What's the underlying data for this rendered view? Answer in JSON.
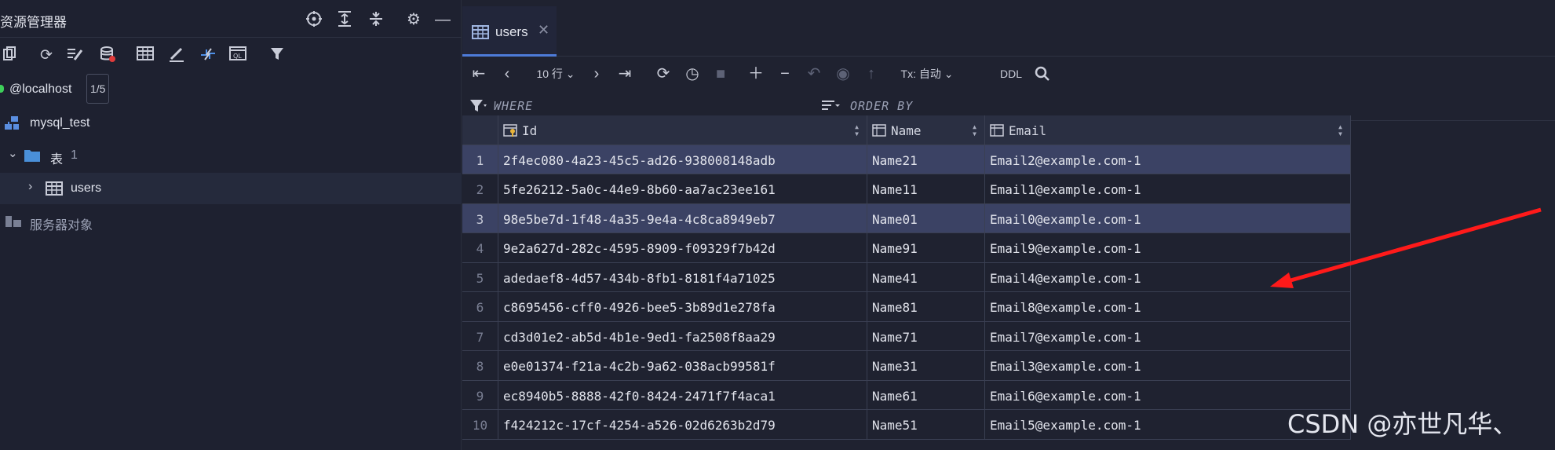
{
  "left_panel": {
    "title": "资源管理器",
    "tree": {
      "connection": {
        "label": "@localhost",
        "badge": "1/5"
      },
      "database": {
        "label": "mysql_test"
      },
      "tables_folder": {
        "label": "表",
        "count": "1"
      },
      "table_item": {
        "label": "users"
      },
      "server_objects": {
        "label": "服务器对象"
      }
    }
  },
  "editor": {
    "tab": {
      "label": "users"
    },
    "toolbar": {
      "page_size": "10 行",
      "tx_mode": "Tx: 自动",
      "ddl": "DDL"
    },
    "filter": {
      "where": "WHERE",
      "order_by": "ORDER BY"
    }
  },
  "table": {
    "columns": [
      "Id",
      "Name",
      "Email"
    ],
    "rows": [
      {
        "num": "1",
        "id": "2f4ec080-4a23-45c5-ad26-938008148adb",
        "name": "Name21",
        "email": "Email2@example.com-1",
        "highlight": true
      },
      {
        "num": "2",
        "id": "5fe26212-5a0c-44e9-8b60-aa7ac23ee161",
        "name": "Name11",
        "email": "Email1@example.com-1",
        "highlight": false
      },
      {
        "num": "3",
        "id": "98e5be7d-1f48-4a35-9e4a-4c8ca8949eb7",
        "name": "Name01",
        "email": "Email0@example.com-1",
        "highlight": true
      },
      {
        "num": "4",
        "id": "9e2a627d-282c-4595-8909-f09329f7b42d",
        "name": "Name91",
        "email": "Email9@example.com-1",
        "highlight": false
      },
      {
        "num": "5",
        "id": "adedaef8-4d57-434b-8fb1-8181f4a71025",
        "name": "Name41",
        "email": "Email4@example.com-1",
        "highlight": false
      },
      {
        "num": "6",
        "id": "c8695456-cff0-4926-bee5-3b89d1e278fa",
        "name": "Name81",
        "email": "Email8@example.com-1",
        "highlight": false
      },
      {
        "num": "7",
        "id": "cd3d01e2-ab5d-4b1e-9ed1-fa2508f8aa29",
        "name": "Name71",
        "email": "Email7@example.com-1",
        "highlight": false
      },
      {
        "num": "8",
        "id": "e0e01374-f21a-4c2b-9a62-038acb99581f",
        "name": "Name31",
        "email": "Email3@example.com-1",
        "highlight": false
      },
      {
        "num": "9",
        "id": "ec8940b5-8888-42f0-8424-2471f7f4aca1",
        "name": "Name61",
        "email": "Email6@example.com-1",
        "highlight": false
      },
      {
        "num": "10",
        "id": "f424212c-17cf-4254-a526-02d6263b2d79",
        "name": "Name51",
        "email": "Email5@example.com-1",
        "highlight": false
      }
    ]
  },
  "watermark": "CSDN @亦世凡华、",
  "colors": {
    "accent": "#4d7bd8",
    "row_highlight": "#3b4264",
    "annotation_arrow": "#ff1a1a",
    "connection_status": "#3ecf5a"
  },
  "icons": [
    "target-icon",
    "expand-all-icon",
    "collapse-all-icon",
    "gear-icon",
    "minimize-icon",
    "copy-icon",
    "refresh-icon",
    "edit-icon",
    "database-icon",
    "table-icon",
    "pen-icon",
    "compare-icon",
    "query-icon",
    "filter-icon",
    "first-page-icon",
    "prev-page-icon",
    "next-page-icon",
    "last-page-icon",
    "reload-icon",
    "history-icon",
    "stop-icon",
    "add-row-icon",
    "delete-row-icon",
    "undo-icon",
    "preview-icon",
    "submit-icon",
    "search-icon",
    "sort-icon",
    "key-icon"
  ]
}
